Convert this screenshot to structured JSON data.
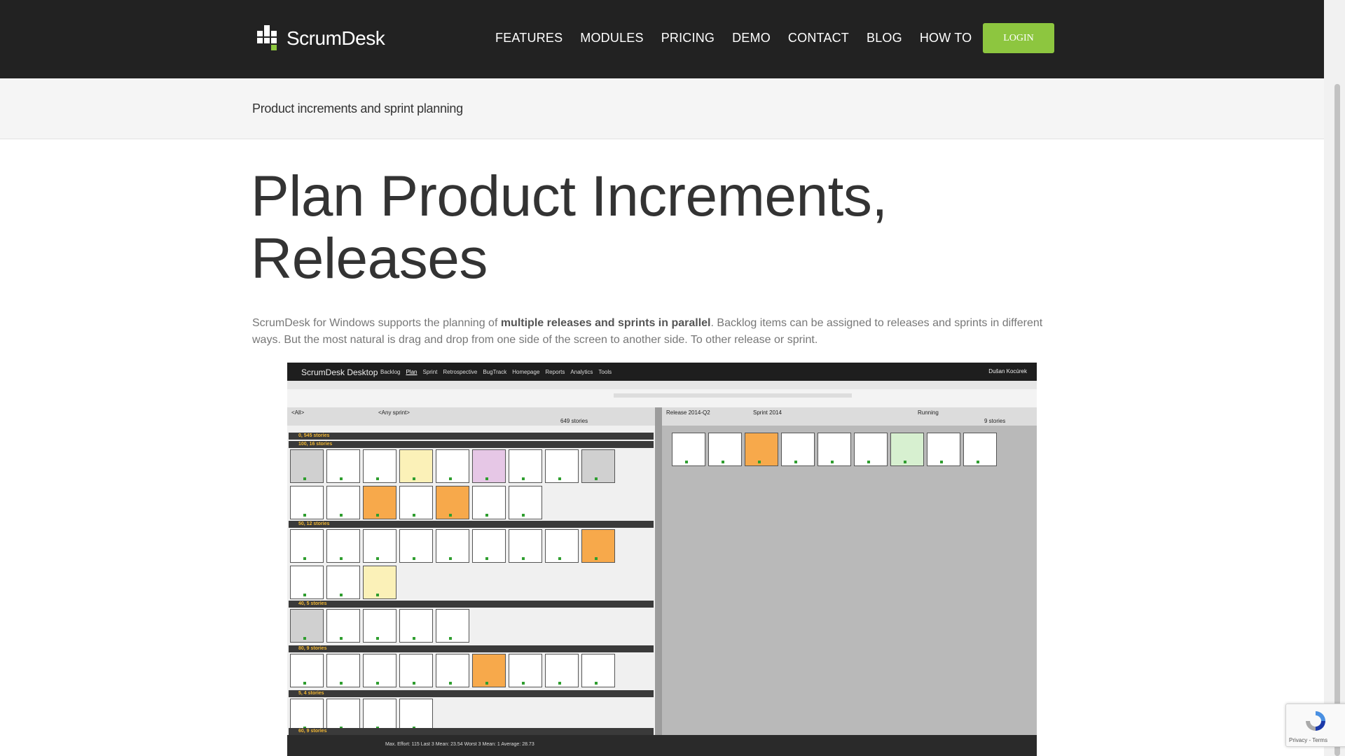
{
  "header": {
    "logo_text": "ScrumDesk",
    "nav": [
      "FEATURES",
      "MODULES",
      "PRICING",
      "DEMO",
      "CONTACT",
      "BLOG",
      "HOW TO"
    ],
    "login_label": "LOGIN"
  },
  "breadcrumb": "Product increments and sprint planning",
  "title_line1": "Plan Product Increments,",
  "title_line2": "Releases",
  "intro": {
    "before": "ScrumDesk for Windows supports the planning of ",
    "bold": "multiple releases and sprints in parallel",
    "after": ". Backlog items can be assigned to releases and sprints in different ways. But the most natural is drag and drop from one side of the screen to another side. To other release or sprint."
  },
  "recaptcha": {
    "text": "Privacy - Terms"
  },
  "colors": {
    "header_bg": "#222222",
    "accent": "#8dc63f"
  },
  "screenshot": {
    "app_name": "ScrumDesk Desktop",
    "menu": [
      "Backlog",
      "Plan",
      "Sprint",
      "Retrospective",
      "BugTrack",
      "Homepage",
      "Reports",
      "Analytics",
      "Tools"
    ],
    "user": "Dušan Kocúrek",
    "left_filter": "<All>",
    "left_filter2": "<Any sprint>",
    "left_count": "649 stories",
    "right_release": "Release 2014-Q2",
    "right_sprint": "Sprint 2014",
    "right_status": "Running",
    "right_count": "9 stories",
    "groups": [
      {
        "label": "0, 545 stories"
      },
      {
        "label": "100, 16 stories"
      },
      {
        "label": "50, 12 stories"
      },
      {
        "label": "40, 5 stories"
      },
      {
        "label": "80, 9 stories"
      },
      {
        "label": "5, 4 stories"
      },
      {
        "label": "60, 9 stories"
      }
    ],
    "status": "Max. Effort: 115   Last 3 Mean: 23.54   Worst 3 Mean: 1   Average: 28.73"
  }
}
